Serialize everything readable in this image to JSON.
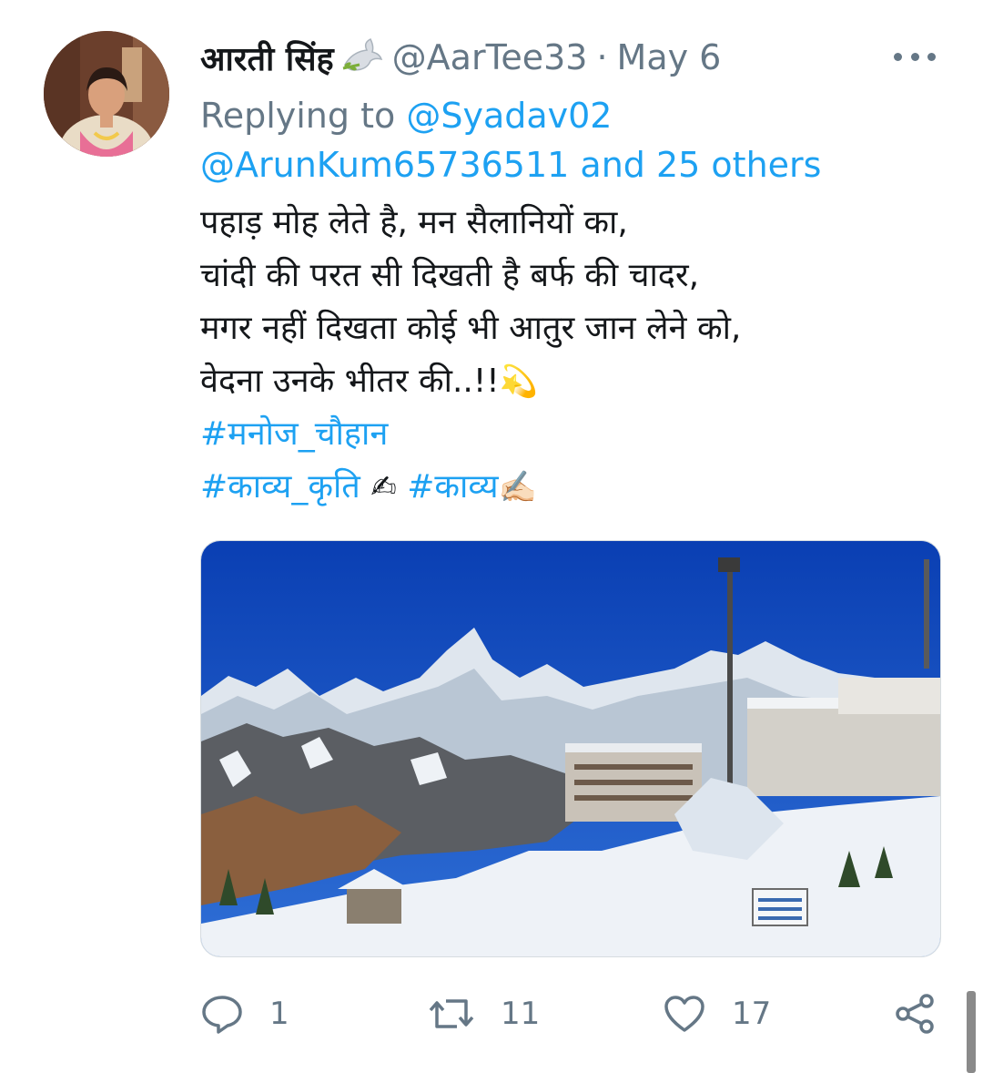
{
  "tweet": {
    "display_name": "आरती सिंह",
    "handle": "@AarTee33",
    "separator": "·",
    "date": "May 6",
    "replying_prefix": "Replying to",
    "reply_user_1": "@Syadav02",
    "reply_user_2": "@ArunKum65736511",
    "reply_others": "and 25 others",
    "lines": [
      "पहाड़ मोह लेते है, मन सैलानियों का,",
      "चांदी की परत सी दिखती है बर्फ की चादर,",
      "मगर नहीं दिखता कोई भी आतुर जान लेने को,",
      "वेदना उनके भीतर की..!!"
    ],
    "line4_emoji": "💫",
    "hashtag_1": "#मनोज_चौहान",
    "hashtag_2": "#काव्य_कृति",
    "emoji_writing_1": "✍",
    "hashtag_3": "#काव्य",
    "emoji_writing_2": "✍🏻"
  },
  "actions": {
    "reply_count": "1",
    "retweet_count": "11",
    "like_count": "17"
  },
  "icons": {
    "dove": "dove-icon",
    "more": "more-icon",
    "reply": "reply-icon",
    "retweet": "retweet-icon",
    "like": "heart-icon",
    "share": "share-icon"
  },
  "colors": {
    "link": "#1da1f2",
    "secondary_text": "#657786",
    "primary_text": "#14171a"
  }
}
